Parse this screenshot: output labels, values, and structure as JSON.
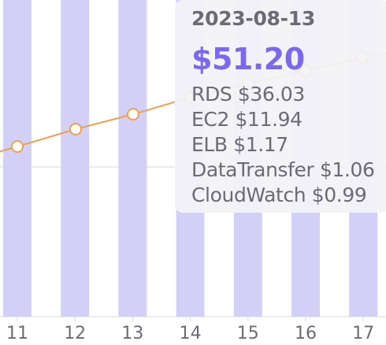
{
  "colors": {
    "bar": "#d2d0f6",
    "line": "#f0a050",
    "grid": "#d8d8d8",
    "tooltip_text": "#6b6b76",
    "total_text": "#7b68ee"
  },
  "tooltip": {
    "date": "2023-08-13",
    "total": "$51.20",
    "rows": [
      {
        "label": "RDS $36.03"
      },
      {
        "label": "EC2 $11.94"
      },
      {
        "label": "ELB $1.17"
      },
      {
        "label": "DataTransfer $1.06"
      },
      {
        "label": "CloudWatch $0.99"
      }
    ]
  },
  "chart_data": {
    "type": "bar",
    "categories": [
      "11",
      "12",
      "13",
      "14",
      "15",
      "16",
      "17"
    ],
    "series": [
      {
        "type": "bar",
        "values": [
          null,
          null,
          null,
          null,
          null,
          null,
          null
        ]
      },
      {
        "type": "line",
        "values": [
          null,
          null,
          null,
          null,
          null,
          null,
          null
        ]
      }
    ],
    "xlabel": "",
    "ylabel": "",
    "grid": true
  }
}
